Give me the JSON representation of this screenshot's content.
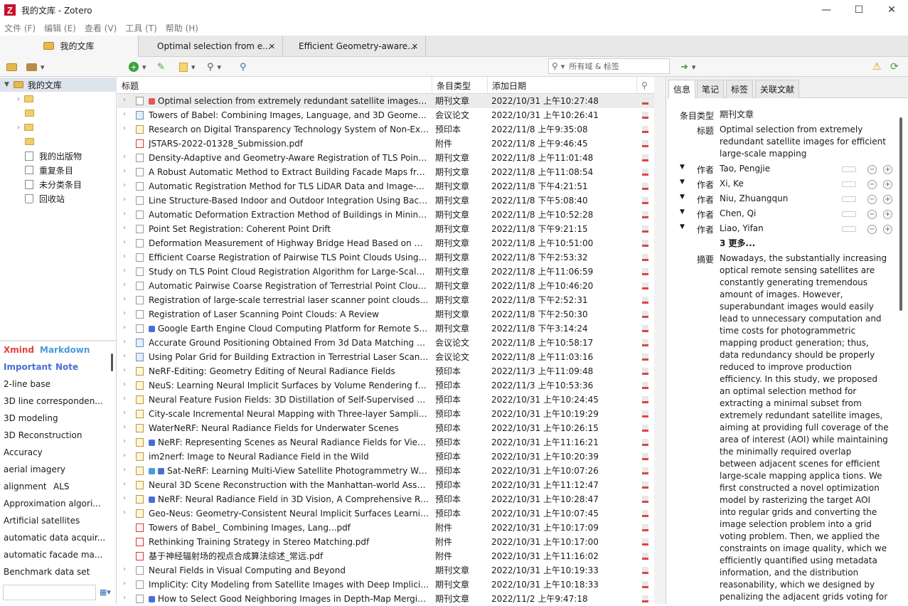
{
  "window": {
    "title": "我的文库 - Zotero",
    "logo": "Z",
    "min": "—",
    "max": "☐",
    "close": "✕"
  },
  "menu": [
    "文件 (F)",
    "编辑 (E)",
    "查看 (V)",
    "工具 (T)",
    "帮助 (H)"
  ],
  "tabs": [
    {
      "label": "我的文库"
    },
    {
      "label": "Optimal selection from e..."
    },
    {
      "label": "Efficient Geometry-aware..."
    }
  ],
  "search": {
    "placeholder": "所有域 & 标签"
  },
  "collections": [
    {
      "label": "我的文库",
      "selected": true
    },
    {
      "label": ""
    },
    {
      "label": ""
    },
    {
      "label": ""
    },
    {
      "label": ""
    },
    {
      "label": "我的出版物"
    },
    {
      "label": "重复条目"
    },
    {
      "label": "未分类条目"
    },
    {
      "label": "回收站"
    }
  ],
  "tags": {
    "colored": [
      {
        "name": "Xmind",
        "color": "#e2413d"
      },
      {
        "name": "Markdown",
        "color": "#4a9bd9"
      },
      {
        "name": "Important",
        "color": "#4a6fd4"
      },
      {
        "name": "Note",
        "color": "#4a6fd4"
      }
    ],
    "list": [
      "2-line base",
      "3D line corresponden...",
      "3D modeling",
      "3D Reconstruction",
      "Accuracy",
      "aerial imagery",
      "alignment",
      "ALS",
      "Approximation algori...",
      "Artificial satellites",
      "automatic data acquir...",
      "automatic facade ma...",
      "Benchmark data set"
    ]
  },
  "columns": {
    "title": "标题",
    "type": "条目类型",
    "date": "添加日期"
  },
  "items": [
    {
      "title": "Optimal selection from extremely redundant satellite images for ...",
      "type": "期刊文章",
      "date": "2022/10/31 上午10:27:48",
      "icon": "doc",
      "dots": [
        "#e85555"
      ],
      "sel": true
    },
    {
      "title": "Towers of Babel: Combining Images, Language, and 3D Geometry ...",
      "type": "会议论文",
      "date": "2022/10/31 上午10:26:41",
      "icon": "conf"
    },
    {
      "title": "Research on Digital Transparency Technology System of Non-Exp...",
      "type": "预印本",
      "date": "2022/11/8 上午9:35:08",
      "icon": "pre"
    },
    {
      "title": "JSTARS-2022-01328_Submission.pdf",
      "type": "附件",
      "date": "2022/11/8 上午9:46:45",
      "icon": "pdf",
      "notwist": true
    },
    {
      "title": "Density-Adaptive and Geometry-Aware Registration of TLS Point C...",
      "type": "期刊文章",
      "date": "2022/11/8 上午11:01:48",
      "icon": "doc"
    },
    {
      "title": "A Robust Automatic Method to Extract Building Facade Maps fro...",
      "type": "期刊文章",
      "date": "2022/11/8 上午11:08:54",
      "icon": "doc"
    },
    {
      "title": "Automatic Registration Method for TLS LiDAR Data and Image-Ba...",
      "type": "期刊文章",
      "date": "2022/11/8 下午4:21:51",
      "icon": "doc"
    },
    {
      "title": "Line Structure-Based Indoor and Outdoor Integration Using Backp...",
      "type": "期刊文章",
      "date": "2022/11/8 下午5:08:40",
      "icon": "doc"
    },
    {
      "title": "Automatic Deformation Extraction Method of Buildings in Mining ...",
      "type": "期刊文章",
      "date": "2022/11/8 上午10:52:28",
      "icon": "doc"
    },
    {
      "title": "Point Set Registration: Coherent Point Drift",
      "type": "期刊文章",
      "date": "2022/11/8 下午9:21:15",
      "icon": "doc"
    },
    {
      "title": "Deformation Measurement of Highway Bridge Head Based on Mo...",
      "type": "期刊文章",
      "date": "2022/11/8 上午10:51:00",
      "icon": "doc"
    },
    {
      "title": "Efficient Coarse Registration of Pairwise TLS Point Clouds Using Or...",
      "type": "期刊文章",
      "date": "2022/11/8 下午2:53:32",
      "icon": "doc"
    },
    {
      "title": "Study on TLS Point Cloud Registration Algorithm for Large-Scale ...",
      "type": "期刊文章",
      "date": "2022/11/8 上午11:06:59",
      "icon": "doc"
    },
    {
      "title": "Automatic Pairwise Coarse Registration of Terrestrial Point Clouds ...",
      "type": "期刊文章",
      "date": "2022/11/8 上午10:46:20",
      "icon": "doc"
    },
    {
      "title": "Registration of large-scale terrestrial laser scanner point clouds: A ...",
      "type": "期刊文章",
      "date": "2022/11/8 下午2:52:31",
      "icon": "doc"
    },
    {
      "title": "Registration of Laser Scanning Point Clouds: A Review",
      "type": "期刊文章",
      "date": "2022/11/8 下午2:50:30",
      "icon": "doc"
    },
    {
      "title": "Google Earth Engine Cloud Computing Platform for Remote Sen...",
      "type": "期刊文章",
      "date": "2022/11/8 下午3:14:24",
      "icon": "doc",
      "dots": [
        "#4a6fd4"
      ]
    },
    {
      "title": "Accurate Ground Positioning Obtained From 3d Data Matching Be...",
      "type": "会议论文",
      "date": "2022/11/8 上午10:58:17",
      "icon": "conf"
    },
    {
      "title": "Using Polar Grid for Building Extraction in Terrestrial Laser Scannin...",
      "type": "会议论文",
      "date": "2022/11/8 上午11:03:16",
      "icon": "conf"
    },
    {
      "title": "NeRF-Editing: Geometry Editing of Neural Radiance Fields",
      "type": "预印本",
      "date": "2022/11/3 上午11:09:48",
      "icon": "pre"
    },
    {
      "title": "NeuS: Learning Neural Implicit Surfaces by Volume Rendering for ...",
      "type": "预印本",
      "date": "2022/11/3 上午10:53:36",
      "icon": "pre"
    },
    {
      "title": "Neural Feature Fusion Fields: 3D Distillation of Self-Supervised 2D ...",
      "type": "预印本",
      "date": "2022/10/31 上午10:24:45",
      "icon": "pre"
    },
    {
      "title": "City-scale Incremental Neural Mapping with Three-layer Sampling ...",
      "type": "预印本",
      "date": "2022/10/31 上午10:19:29",
      "icon": "pre"
    },
    {
      "title": "WaterNeRF: Neural Radiance Fields for Underwater Scenes",
      "type": "预印本",
      "date": "2022/10/31 上午10:26:15",
      "icon": "pre"
    },
    {
      "title": "NeRF: Representing Scenes as Neural Radiance Fields for View S...",
      "type": "预印本",
      "date": "2022/10/31 上午11:16:21",
      "icon": "pre",
      "dots": [
        "#4a6fd4"
      ]
    },
    {
      "title": "im2nerf: Image to Neural Radiance Field in the Wild",
      "type": "预印本",
      "date": "2022/10/31 上午10:20:39",
      "icon": "pre"
    },
    {
      "title": "Sat-NeRF: Learning Multi-View Satellite Photogrammetry With...",
      "type": "预印本",
      "date": "2022/10/31 上午10:07:26",
      "icon": "pre",
      "dots": [
        "#4a9bd9",
        "#4a6fd4"
      ]
    },
    {
      "title": "Neural 3D Scene Reconstruction with the Manhattan-world Assum...",
      "type": "预印本",
      "date": "2022/10/31 上午11:12:47",
      "icon": "pre"
    },
    {
      "title": "NeRF: Neural Radiance Field in 3D Vision, A Comprehensive Revi...",
      "type": "预印本",
      "date": "2022/10/31 上午10:28:47",
      "icon": "pre",
      "dots": [
        "#4a6fd4"
      ]
    },
    {
      "title": "Geo-Neus: Geometry-Consistent Neural Implicit Surfaces Learning...",
      "type": "预印本",
      "date": "2022/10/31 上午10:07:45",
      "icon": "pre"
    },
    {
      "title": "Towers of Babel_ Combining Images, Lang...pdf",
      "type": "附件",
      "date": "2022/10/31 上午10:17:09",
      "icon": "pdf",
      "notwist": true
    },
    {
      "title": "Rethinking Training Strategy in Stereo Matching.pdf",
      "type": "附件",
      "date": "2022/10/31 上午10:17:00",
      "icon": "pdf",
      "notwist": true
    },
    {
      "title": "基于神经辐射场的视点合成算法综述_常远.pdf",
      "type": "附件",
      "date": "2022/10/31 上午11:16:02",
      "icon": "pdf",
      "notwist": true
    },
    {
      "title": "Neural Fields in Visual Computing and Beyond",
      "type": "期刊文章",
      "date": "2022/10/31 上午10:19:33",
      "icon": "doc"
    },
    {
      "title": "ImpliCity: City Modeling from Satellite Images with Deep Implicit ...",
      "type": "期刊文章",
      "date": "2022/10/31 上午10:18:33",
      "icon": "doc"
    },
    {
      "title": "How to Select Good Neighboring Images in Depth-Map Mergin...",
      "type": "期刊文章",
      "date": "2022/11/2 上午9:47:18",
      "icon": "doc",
      "dots": [
        "#4a6fd4"
      ]
    }
  ],
  "detail": {
    "tabs": [
      "信息",
      "笔记",
      "标签",
      "关联文献"
    ],
    "type_label": "条目类型",
    "type_value": "期刊文章",
    "title_label": "标题",
    "title_value": "Optimal selection from extremely redundant satellite images for efficient large-scale mapping",
    "author_label": "作者",
    "authors": [
      "Tao, Pengjie",
      "Xi, Ke",
      "Niu, Zhuangqun",
      "Chen, Qi",
      "Liao, Yifan"
    ],
    "more": "3 更多...",
    "abstract_label": "摘要",
    "abstract": "Nowadays, the substantially increasing optical remote sensing satellites are constantly generating tremendous amount of images. However, superabundant images would easily lead to unnecessary computation and time costs for photogrammetric mapping product generation; thus, data redundancy should be properly reduced to improve production efficiency. In this study, we proposed an optimal selection method for extracting a minimal subset from extremely redundant satellite images, aiming at providing full coverage of the area of interest (AOI) while maintaining the minimally required overlap between adjacent scenes for efficient large-scale mapping applica tions. We first constructed a novel optimization model by rasterizing the target AOI into regular grids and converting the image selection problem into a grid voting problem. Then, we applied the constraints on image quality, which we efficiently quantified using metadata information, and the distribution reasonability, which we designed by penalizing the adjacent grids voting for different images, to the"
  }
}
